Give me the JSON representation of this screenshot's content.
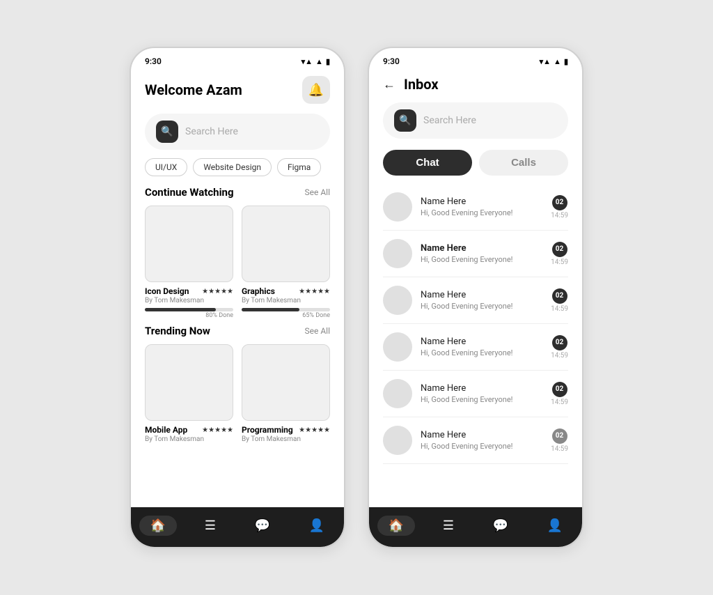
{
  "screen1": {
    "status_time": "9:30",
    "welcome_label": "Welcome",
    "user_name": "Azam",
    "search_placeholder": "Search Here",
    "tags": [
      "UI/UX",
      "Website Design",
      "Figma"
    ],
    "continue_watching": {
      "title": "Continue Watching",
      "see_all": "See All",
      "courses": [
        {
          "name": "Icon Design",
          "author": "By Tom Makesman",
          "stars": "★★★★★",
          "progress": 80,
          "progress_label": "80% Done"
        },
        {
          "name": "Graphics",
          "author": "By Tom Makesman",
          "stars": "★★★★★",
          "progress": 65,
          "progress_label": "65% Done"
        }
      ]
    },
    "trending_now": {
      "title": "Trending Now",
      "see_all": "See All",
      "courses": [
        {
          "name": "Mobile App",
          "author": "By Tom Makesman",
          "stars": "★★★★★"
        },
        {
          "name": "Programming",
          "author": "By Tom Makesman",
          "stars": "★★★★★"
        }
      ]
    },
    "nav": [
      "🏠",
      "☰",
      "💬",
      "👤"
    ]
  },
  "screen2": {
    "status_time": "9:30",
    "back_label": "←",
    "title": "Inbox",
    "search_placeholder": "Search Here",
    "tabs": [
      {
        "label": "Chat",
        "active": true
      },
      {
        "label": "Calls",
        "active": false
      }
    ],
    "chats": [
      {
        "name": "Name Here",
        "message": "Hi, Good Evening Everyone!",
        "time": "14:59",
        "badge": "02",
        "bold": false
      },
      {
        "name": "Name Here",
        "message": "Hi, Good Evening Everyone!",
        "time": "14:59",
        "badge": "02",
        "bold": true
      },
      {
        "name": "Name Here",
        "message": "Hi, Good Evening Everyone!",
        "time": "14:59",
        "badge": "02",
        "bold": false
      },
      {
        "name": "Name Here",
        "message": "Hi, Good Evening Everyone!",
        "time": "14:59",
        "badge": "02",
        "bold": false
      },
      {
        "name": "Name Here",
        "message": "Hi, Good Evening Everyone!",
        "time": "14:59",
        "badge": "02",
        "bold": false
      },
      {
        "name": "Name Here",
        "message": "Hi, Good Evening Everyone!",
        "time": "14:59",
        "badge": "02",
        "bold": false
      }
    ],
    "nav": [
      "🏠",
      "☰",
      "💬",
      "👤"
    ]
  }
}
